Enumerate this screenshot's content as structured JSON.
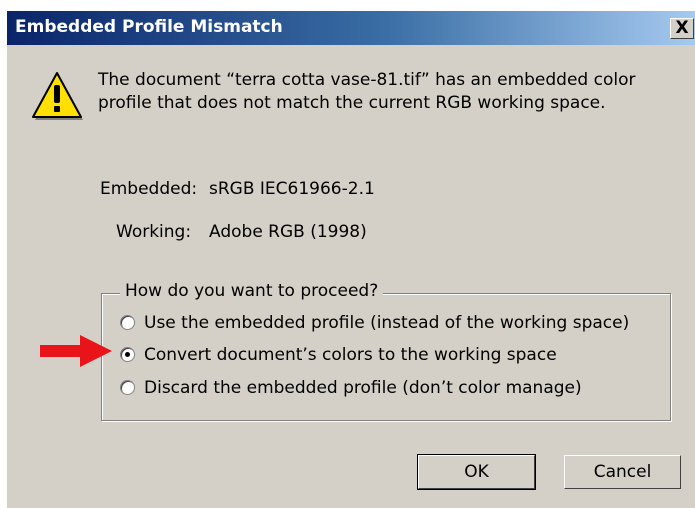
{
  "window": {
    "title": "Embedded Profile Mismatch",
    "close_label": "X"
  },
  "message": {
    "line1": "The document “terra cotta vase-81.tif” has an embedded color",
    "line2": "profile that does not match the current RGB working space."
  },
  "info": {
    "embedded_label": "Embedded:",
    "embedded_value": "sRGB IEC61966-2.1",
    "working_label": "Working:",
    "working_value": "Adobe RGB (1998)"
  },
  "proceed": {
    "legend": "How do you want to proceed?",
    "options": [
      {
        "label": "Use the embedded profile (instead of the working space)",
        "checked": false
      },
      {
        "label": "Convert document’s colors to the working space",
        "checked": true
      },
      {
        "label": "Discard the embedded profile (don’t color manage)",
        "checked": false
      }
    ]
  },
  "buttons": {
    "ok": "OK",
    "cancel": "Cancel"
  },
  "icons": {
    "warning": "warning-icon",
    "arrow": "red-arrow-icon",
    "close": "close-icon"
  },
  "colors": {
    "titlebar_start": "#0a246a",
    "titlebar_end": "#a6caf0",
    "dialog_bg": "#d4d0c8",
    "warning_fill": "#ffe000",
    "arrow": "#e8141a"
  }
}
